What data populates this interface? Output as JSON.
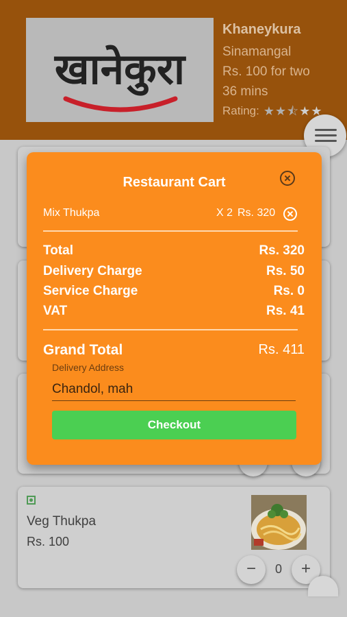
{
  "restaurant": {
    "logo_text": "खानेकुरा",
    "name": "Khaneykura",
    "location": "Sinamangal",
    "cost_for_two": "Rs. 100 for two",
    "delivery_time": "36 mins",
    "rating_label": "Rating:",
    "rating_value": 2.5,
    "rating_max": 5
  },
  "cart": {
    "title": "Restaurant Cart",
    "items": [
      {
        "name": "Mix Thukpa",
        "qty": "X 2",
        "price": "Rs. 320"
      }
    ],
    "summary": {
      "total_label": "Total",
      "total_value": "Rs. 320",
      "delivery_label": "Delivery Charge",
      "delivery_value": "Rs. 50",
      "service_label": "Service Charge",
      "service_value": "Rs. 0",
      "vat_label": "VAT",
      "vat_value": "Rs. 41"
    },
    "grand_total_label": "Grand Total",
    "grand_total_value": "Rs. 411",
    "address_label": "Delivery Address",
    "address_value": "Chandol, mah",
    "checkout_label": "Checkout"
  },
  "menu_item": {
    "name": "Veg Thukpa",
    "price": "Rs. 100",
    "quantity": "0",
    "minus": "−",
    "plus": "+"
  },
  "colors": {
    "header": "#97520c",
    "modal": "#fb8c1d",
    "checkout": "#4bcf52",
    "veg": "#4f9a55"
  }
}
